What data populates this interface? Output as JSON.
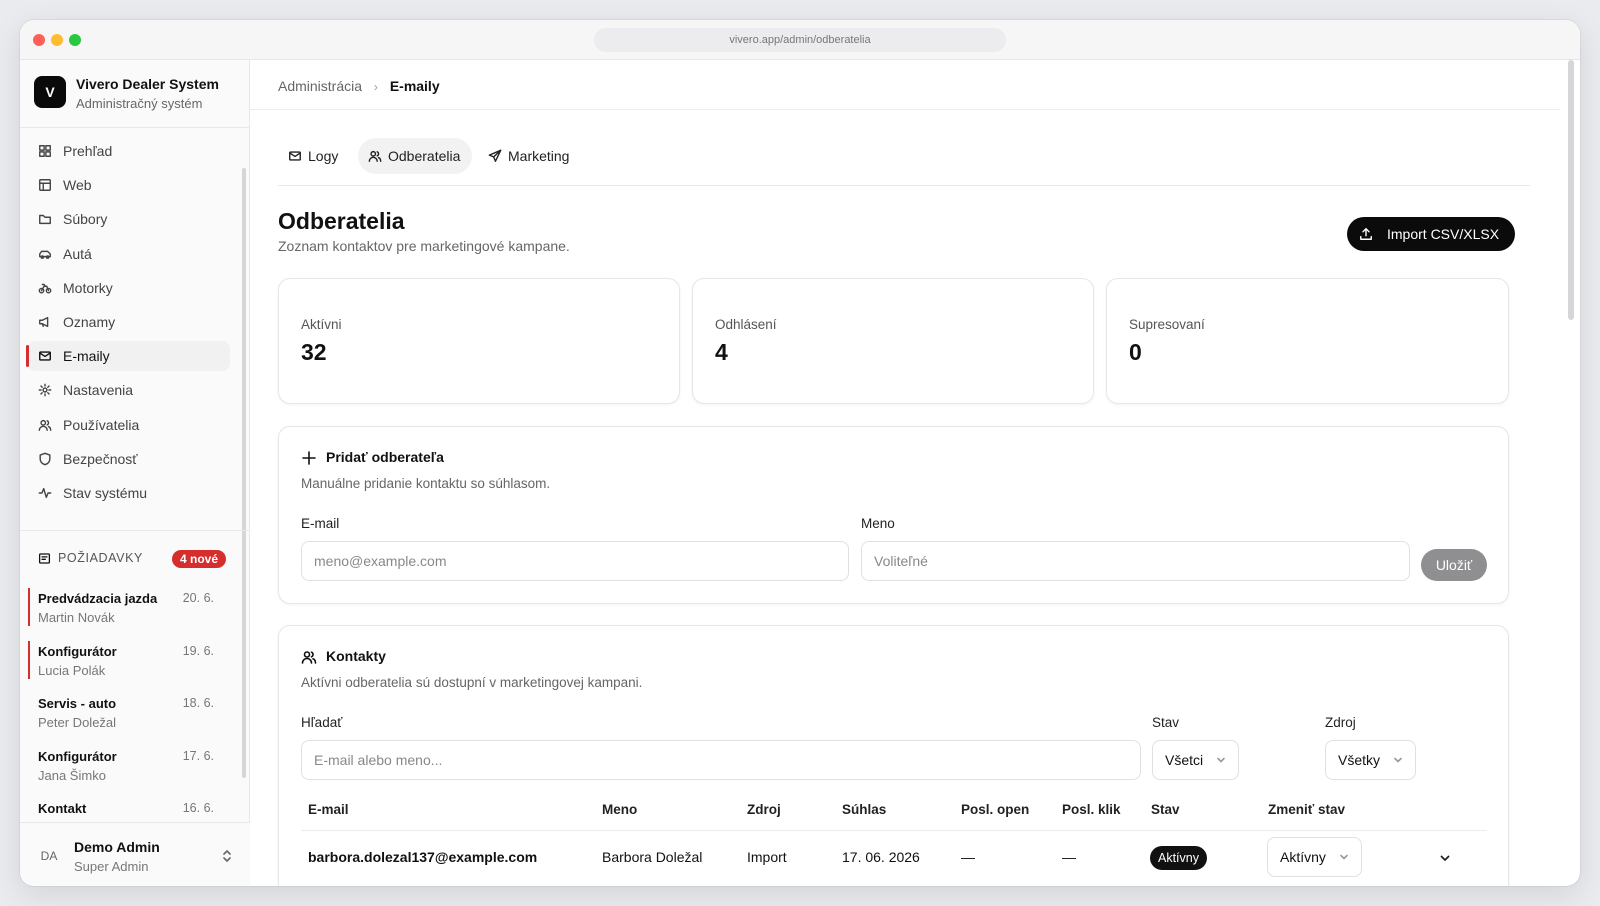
{
  "browser": {
    "url": "vivero.app/admin/odberatelia"
  },
  "brand": {
    "logo_letter": "V",
    "title": "Vivero Dealer System",
    "subtitle": "Administračný systém"
  },
  "sidebar": {
    "items": [
      {
        "label": "Prehľad",
        "icon": "grid-icon"
      },
      {
        "label": "Web",
        "icon": "layout-icon"
      },
      {
        "label": "Súbory",
        "icon": "folder-icon"
      },
      {
        "label": "Autá",
        "icon": "car-icon"
      },
      {
        "label": "Motorky",
        "icon": "bike-icon"
      },
      {
        "label": "Oznamy",
        "icon": "megaphone-icon"
      },
      {
        "label": "E-maily",
        "icon": "mail-icon",
        "active": true
      },
      {
        "label": "Nastavenia",
        "icon": "gear-icon"
      },
      {
        "label": "Používatelia",
        "icon": "users-icon"
      },
      {
        "label": "Bezpečnosť",
        "icon": "shield-icon"
      },
      {
        "label": "Stav systému",
        "icon": "activity-icon"
      }
    ],
    "requests": {
      "title": "POŽIADAVKY",
      "badge": "4 nové",
      "items": [
        {
          "name": "Predvádzacia jazda",
          "person": "Martin Novák",
          "date": "20. 6.",
          "unread": true
        },
        {
          "name": "Konfigurátor",
          "person": "Lucia Polák",
          "date": "19. 6.",
          "unread": true
        },
        {
          "name": "Servis - auto",
          "person": "Peter Doležal",
          "date": "18. 6.",
          "unread": false
        },
        {
          "name": "Konfigurátor",
          "person": "Jana Šimko",
          "date": "17. 6.",
          "unread": false
        },
        {
          "name": "Kontakt",
          "person": "",
          "date": "16. 6.",
          "unread": false
        }
      ]
    },
    "user": {
      "initials": "DA",
      "name": "Demo Admin",
      "role": "Super Admin"
    }
  },
  "breadcrumb": {
    "parent": "Administrácia",
    "current": "E-maily"
  },
  "tabs": [
    {
      "label": "Logy",
      "icon": "mail-icon"
    },
    {
      "label": "Odberatelia",
      "icon": "users-icon",
      "active": true
    },
    {
      "label": "Marketing",
      "icon": "send-icon"
    }
  ],
  "page": {
    "title": "Odberatelia",
    "subtitle": "Zoznam kontaktov pre marketingové kampane.",
    "import_label": "Import CSV/XLSX"
  },
  "stats": [
    {
      "label": "Aktívni",
      "value": "32"
    },
    {
      "label": "Odhlásení",
      "value": "4"
    },
    {
      "label": "Supresovaní",
      "value": "0"
    }
  ],
  "add_form": {
    "title": "Pridať odberateľa",
    "subtitle": "Manuálne pridanie kontaktu so súhlasom.",
    "email_label": "E-mail",
    "email_placeholder": "meno@example.com",
    "name_label": "Meno",
    "name_placeholder": "Voliteľné",
    "save_label": "Uložiť"
  },
  "contacts": {
    "title": "Kontakty",
    "subtitle": "Aktívni odberatelia sú dostupní v marketingovej kampani.",
    "search_label": "Hľadať",
    "search_placeholder": "E-mail alebo meno...",
    "status_label": "Stav",
    "status_value": "Všetci",
    "source_label": "Zdroj",
    "source_value": "Všetky",
    "columns": [
      "E-mail",
      "Meno",
      "Zdroj",
      "Súhlas",
      "Posl. open",
      "Posl. klik",
      "Stav",
      "Zmeniť stav"
    ],
    "rows": [
      {
        "email": "barbora.dolezal137@example.com",
        "name": "Barbora Doležal",
        "source": "Import",
        "consent": "17. 06. 2026",
        "last_open": "—",
        "last_click": "—",
        "status": "Aktívny",
        "change_status": "Aktívny"
      }
    ]
  },
  "colors": {
    "accent_red": "#d62d2d",
    "primary_black": "#0b0b0c"
  }
}
